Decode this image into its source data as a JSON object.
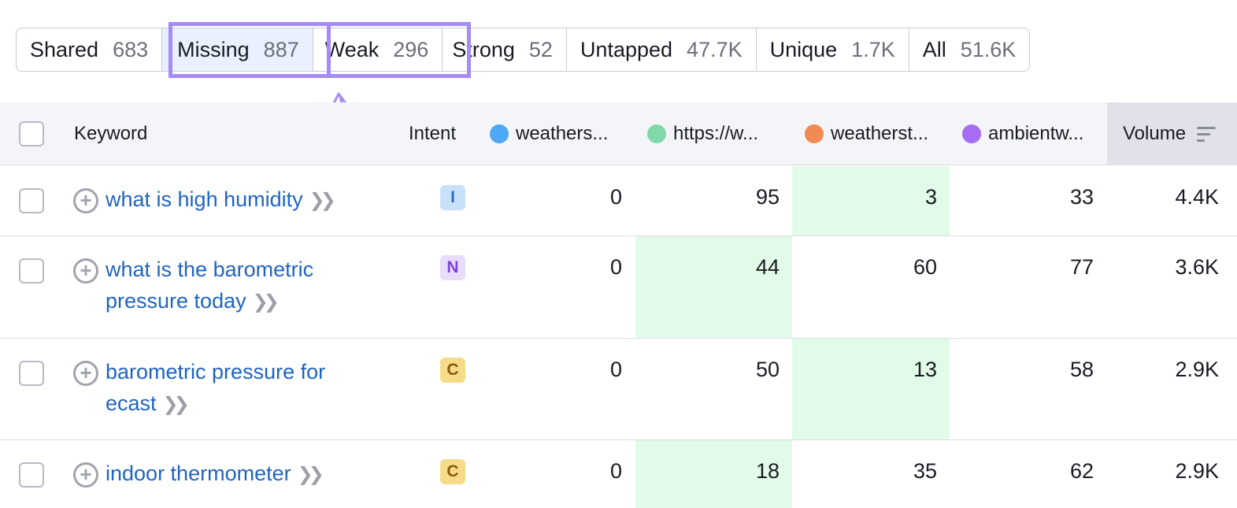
{
  "tabs": [
    {
      "label": "Shared",
      "count": "683"
    },
    {
      "label": "Missing",
      "count": "887"
    },
    {
      "label": "Weak",
      "count": "296"
    },
    {
      "label": "Strong",
      "count": "52"
    },
    {
      "label": "Untapped",
      "count": "47.7K"
    },
    {
      "label": "Unique",
      "count": "1.7K"
    },
    {
      "label": "All",
      "count": "51.6K"
    }
  ],
  "highlight_color": "#a58cf3",
  "table": {
    "headers": {
      "keyword": "Keyword",
      "intent": "Intent",
      "domains": [
        {
          "label": "weathers...",
          "color": "#4ea8f6"
        },
        {
          "label": "https://w...",
          "color": "#7fd9a8"
        },
        {
          "label": "weatherst...",
          "color": "#ef8b52"
        },
        {
          "label": "ambientw...",
          "color": "#a66df2"
        }
      ],
      "volume": "Volume"
    },
    "rows": [
      {
        "keyword": "what is high humidity",
        "intent": "I",
        "positions": [
          "0",
          "95",
          "3",
          "33"
        ],
        "volume": "4.4K"
      },
      {
        "keyword": "what is the barometric pressure today",
        "intent": "N",
        "positions": [
          "0",
          "44",
          "60",
          "77"
        ],
        "volume": "3.6K"
      },
      {
        "keyword": "barometric pressure for ecast",
        "intent": "C",
        "positions": [
          "0",
          "50",
          "13",
          "58"
        ],
        "volume": "2.9K"
      },
      {
        "keyword": "indoor thermometer",
        "intent": "C",
        "positions": [
          "0",
          "18",
          "35",
          "62"
        ],
        "volume": "2.9K"
      }
    ]
  },
  "intent_colors": {
    "I": {
      "bg": "#c8e1fb",
      "fg": "#2a6bc9"
    },
    "N": {
      "bg": "#e8dcfb",
      "fg": "#7b45d9"
    },
    "C": {
      "bg": "#f6dc8a",
      "fg": "#8a5a0c"
    }
  },
  "icons": {
    "plus": "plus-circle-icon",
    "chevron": "double-chevron-right-icon",
    "sort": "sort-icon",
    "arrow": "curved-arrow-icon"
  }
}
